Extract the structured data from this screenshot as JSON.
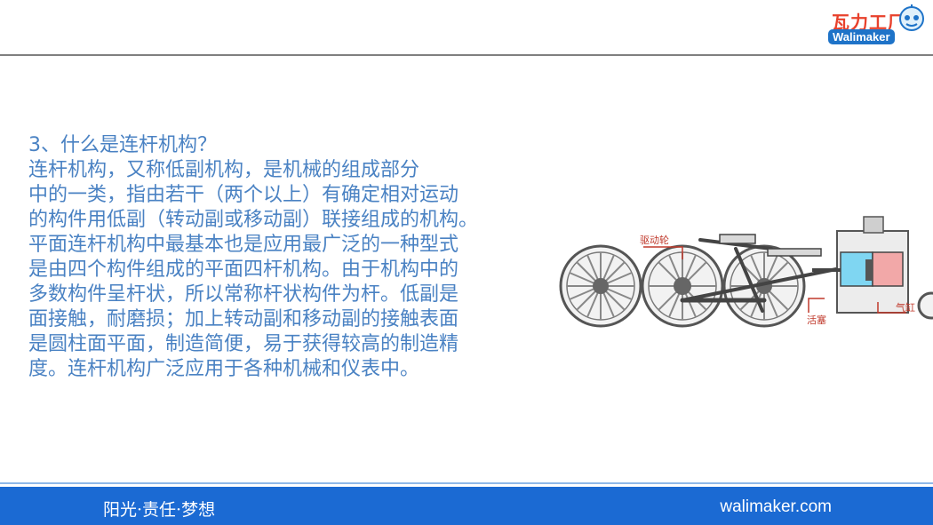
{
  "header": {
    "logo_cn": "瓦力工厂",
    "logo_en": "Walimaker"
  },
  "content": {
    "heading": "3、什么是连杆机构？",
    "paragraph_lines": [
      "    连杆机构，又称低副机构，是机械的组成部分",
      "中的一类，指由若干（两个以上）有确定相对运动",
      "的构件用低副（转动副或移动副）联接组成的机构。",
      "平面连杆机构中最基本也是应用最广泛的一种型式",
      "是由四个构件组成的平面四杆机构。由于机构中的",
      "多数构件呈杆状，所以常称杆状构件为杆。低副是",
      "面接触，耐磨损；加上转动副和移动副的接触表面",
      "是圆柱面平面，制造简便，易于获得较高的制造精",
      "度。连杆机构广泛应用于各种机械和仪表中。"
    ]
  },
  "figure": {
    "label_drive_wheel": "驱动轮",
    "label_piston": "活塞",
    "label_cylinder": "气缸"
  },
  "footer": {
    "motto": "阳光·责任·梦想",
    "site": "walimaker.com"
  },
  "colors": {
    "text_blue": "#4a82c3",
    "footer_blue": "#1b6ad3",
    "logo_red": "#e8412c",
    "figure_red": "#c0392b"
  }
}
